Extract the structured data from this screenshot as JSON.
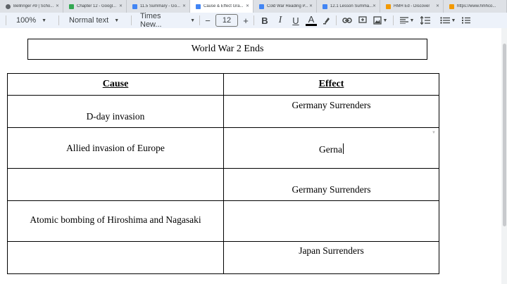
{
  "tabs": [
    {
      "label": "Bellringer #9 | Scho...",
      "favicon_color": "#5f6368",
      "active": false
    },
    {
      "label": "Chapter 12 - Googl...",
      "favicon_color": "#34a853",
      "active": false
    },
    {
      "label": "11.5 Summary - Go...",
      "favicon_color": "#4285f4",
      "active": false
    },
    {
      "label": "Cause & Effect Gra...",
      "favicon_color": "#4285f4",
      "active": true
    },
    {
      "label": "Cold War Reading P...",
      "favicon_color": "#4285f4",
      "active": false
    },
    {
      "label": "12.1 Lesson Summa...",
      "favicon_color": "#4285f4",
      "active": false
    },
    {
      "label": "HMH Ed - Discover",
      "favicon_color": "#f29900",
      "active": false
    },
    {
      "label": "https://www.hmhco...",
      "favicon_color": "#f29900",
      "active": false
    }
  ],
  "toolbar": {
    "zoom": "100%",
    "style": "Normal text",
    "font": "Times New...",
    "minus": "−",
    "font_size": "12",
    "plus": "+",
    "bold": "B",
    "italic": "I",
    "underline": "U",
    "text_color": "A"
  },
  "document": {
    "title": "World War 2 Ends",
    "headers": {
      "cause": "Cause",
      "effect": "Effect"
    },
    "rows": [
      {
        "cause": "D-day invasion",
        "effect": "Germany Surrenders"
      },
      {
        "cause": "Allied invasion of Europe",
        "effect": "Gerna"
      },
      {
        "cause": "",
        "effect": "Germany Surrenders"
      },
      {
        "cause": "Atomic bombing of Hiroshima and Nagasaki",
        "effect": ""
      },
      {
        "cause": "",
        "effect": "Japan Surrenders"
      }
    ]
  }
}
